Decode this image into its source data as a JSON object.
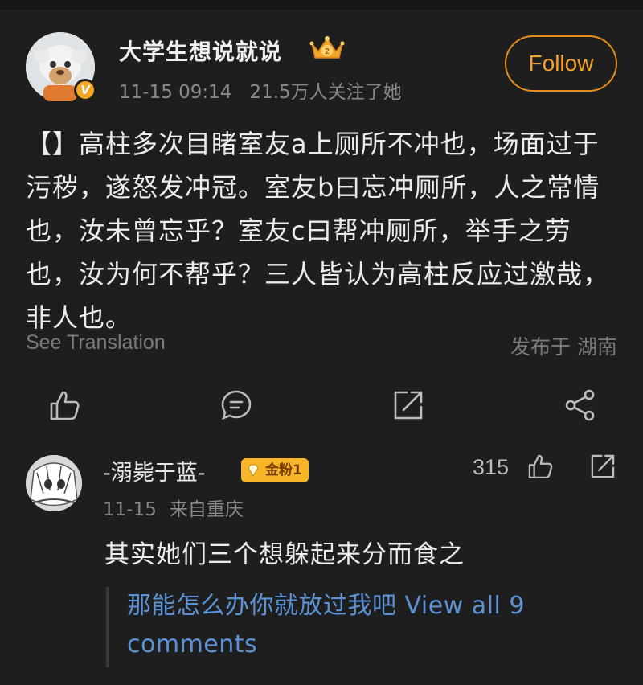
{
  "post": {
    "author": "大学生想说就说",
    "verified_badge": "V",
    "time": "11-15 09:14",
    "followers": "21.5万人关注了她",
    "follow_label": "Follow",
    "body": "【】高柱多次目睹室友a上厕所不冲也，场面过于污秽，遂怒发冲冠。室友b曰忘冲厕所，人之常情也，汝未曾忘乎？室友c曰帮冲厕所，举手之劳也，汝为何不帮乎？三人皆认为高柱反应过激哉，非人也。",
    "translate_label": "See Translation",
    "location": "发布于 湖南"
  },
  "actions": {
    "icons": [
      "thumbs-up-icon",
      "comment-icon",
      "repost-icon",
      "share-icon"
    ]
  },
  "comment": {
    "author": "-溺毙于蓝-",
    "badge": "金粉1",
    "date": "11-15",
    "origin": "来自重庆",
    "like_count": "315",
    "text": "其实她们三个想躲起来分而食之",
    "reply_preview": "那能怎么办你就放过我吧 View all 9 comments"
  },
  "colors": {
    "background": "#1e1e1e",
    "accent": "#f4a12e",
    "link": "#5b92d6",
    "secondary_text": "#8a8a8a"
  }
}
